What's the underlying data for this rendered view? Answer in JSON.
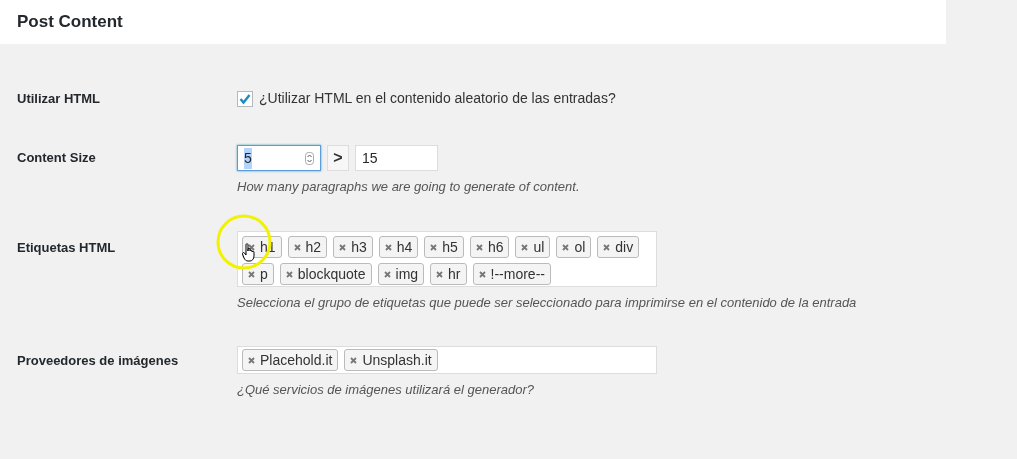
{
  "section_title": "Post Content",
  "fields": [
    {
      "kind": "checkbox",
      "label": "Utilizar HTML",
      "checked": true,
      "text": "¿Utilizar HTML en el contenido aleatorio de las entradas?"
    },
    {
      "kind": "range",
      "label": "Content Size",
      "min": {
        "value": "5",
        "focused": true
      },
      "separator": ">",
      "max": {
        "value": "15",
        "focused": false
      },
      "description": "How many paragraphs we are going to generate of content."
    },
    {
      "kind": "tags",
      "label": "Etiquetas HTML",
      "tags": [
        "h1",
        "h2",
        "h3",
        "h4",
        "h5",
        "h6",
        "ul",
        "ol",
        "div",
        "p",
        "blockquote",
        "img",
        "hr",
        "!--more--"
      ],
      "description": "Selecciona el grupo de etiquetas que puede ser seleccionado para imprimirse en el contenido de la entrada"
    },
    {
      "kind": "tags",
      "label": "Proveedores de imágenes",
      "tags": [
        "Placehold.it",
        "Unsplash.it"
      ],
      "description": "¿Qué servicios de imágenes utilizará el generador?"
    }
  ]
}
